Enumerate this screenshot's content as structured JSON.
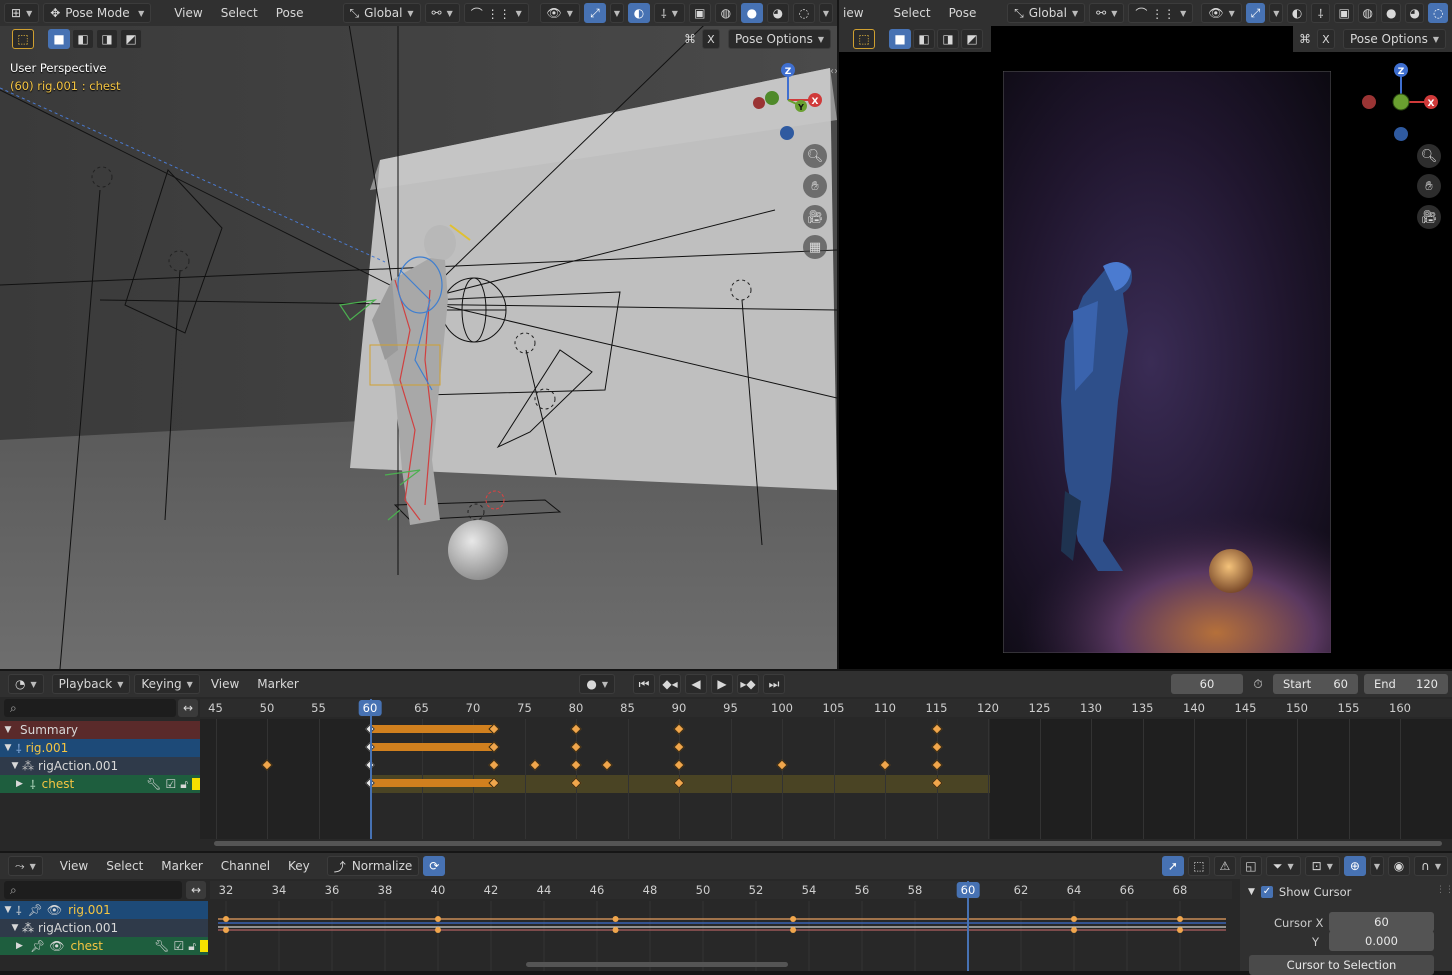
{
  "viewport_left": {
    "mode": "Pose Mode",
    "menus": [
      "View",
      "Select",
      "Pose"
    ],
    "orientation": "Global",
    "pose_options": "Pose Options",
    "overlay_title": "User Perspective",
    "overlay_subtitle": "(60) rig.001 : chest",
    "axis_labels": {
      "z": "Z",
      "x": "X",
      "y": "Y"
    }
  },
  "viewport_right": {
    "menus": [
      "iew",
      "Select",
      "Pose"
    ],
    "orientation": "Global",
    "pose_options": "Pose Options",
    "axis_labels": {
      "z": "Z",
      "x": "X"
    }
  },
  "timeline": {
    "menus": [
      "Playback",
      "Keying",
      "View",
      "Marker"
    ],
    "current_frame": "60",
    "start_label": "Start",
    "start_value": "60",
    "end_label": "End",
    "end_value": "120",
    "ruler": [
      "45",
      "50",
      "55",
      "60",
      "65",
      "70",
      "75",
      "80",
      "85",
      "90",
      "95",
      "100",
      "105",
      "110",
      "115",
      "120",
      "125",
      "130",
      "135",
      "140",
      "145",
      "150",
      "155",
      "160"
    ],
    "channels": [
      {
        "label": "Summary"
      },
      {
        "label": "rig.001"
      },
      {
        "label": "rigAction.001"
      },
      {
        "label": "chest"
      }
    ]
  },
  "graph_editor": {
    "menus": [
      "View",
      "Select",
      "Marker",
      "Channel",
      "Key"
    ],
    "normalize_label": "Normalize",
    "current_frame": "60",
    "ruler": [
      "32",
      "34",
      "36",
      "38",
      "40",
      "42",
      "44",
      "46",
      "48",
      "50",
      "52",
      "54",
      "56",
      "58",
      "60",
      "62",
      "64",
      "66",
      "68"
    ],
    "channels": [
      {
        "label": "rig.001"
      },
      {
        "label": "rigAction.001"
      },
      {
        "label": "chest"
      }
    ],
    "sidebar": {
      "show_cursor_label": "Show Cursor",
      "cursor_x_label": "Cursor X",
      "cursor_x_value": "60",
      "y_label": "Y",
      "y_value": "0.000",
      "cursor_to_selection": "Cursor to Selection"
    }
  },
  "colors": {
    "accent": "#4772b3",
    "keyframe": "#f0a64c",
    "selected_text": "#f5c542",
    "rig_row": "#1d4a78",
    "chest_row": "#1e5e3e",
    "summary_row": "#5a2a2a"
  }
}
